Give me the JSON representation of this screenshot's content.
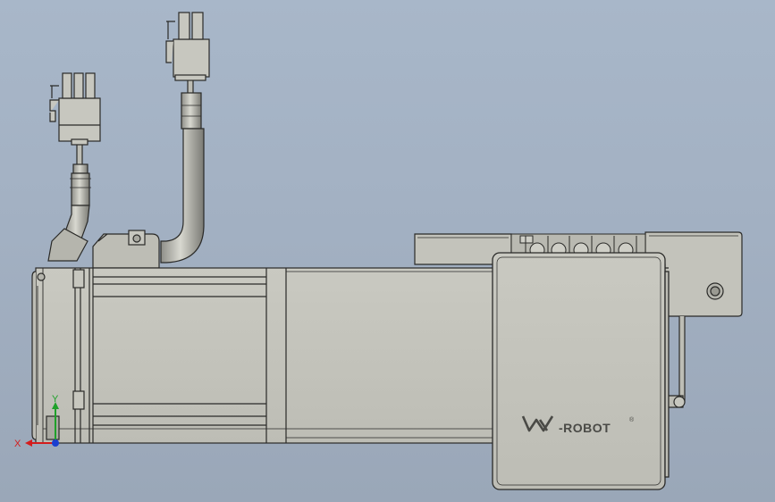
{
  "model": {
    "brand_logo": {
      "text": "-ROBOT",
      "mark": "®"
    }
  },
  "triad": {
    "x_label": "X",
    "y_label": "Y",
    "x_color": "#d41c1c",
    "y_color": "#1fa12a",
    "z_color": "#1a3fd0"
  },
  "colors": {
    "background_top": "#a8b7c9",
    "background_bottom": "#9aa7b8",
    "body_fill": "#c3c3bb",
    "body_stroke": "#2a2a28"
  }
}
